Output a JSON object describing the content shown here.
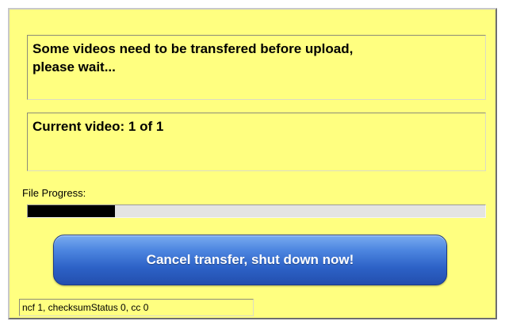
{
  "message": {
    "line1": "Some videos need to be transfered before upload,",
    "line2": "please wait..."
  },
  "current_video": "Current video: 1 of 1",
  "progress": {
    "label": "File Progress:",
    "value": 0.19
  },
  "cancel_button_label": "Cancel transfer, shut down now!",
  "status_text": "ncf 1, checksumStatus 0, cc 0",
  "colors": {
    "panel_background": "#ffff80",
    "progress_fill": "#000000",
    "button_blue": "#2d62c7"
  }
}
